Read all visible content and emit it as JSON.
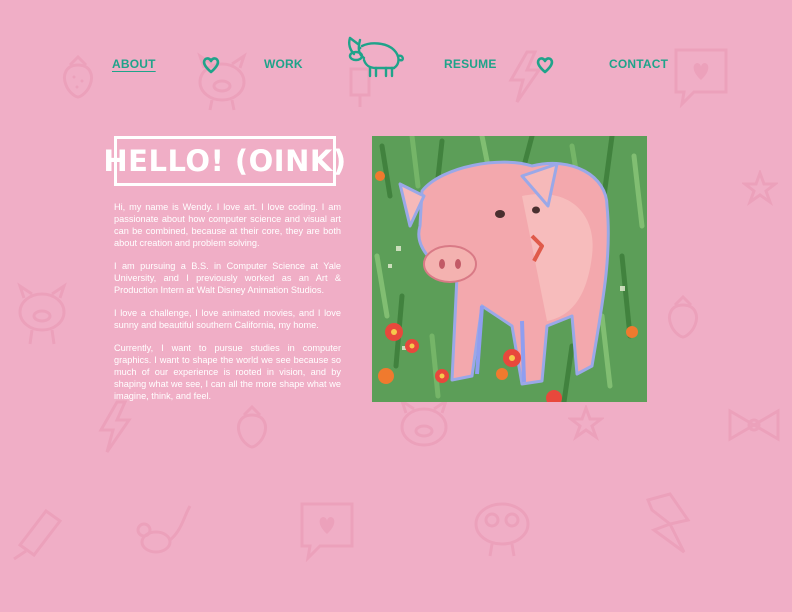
{
  "nav": {
    "about": "ABOUT",
    "work": "WORK",
    "resume": "RESUME",
    "contact": "CONTACT",
    "active": "about"
  },
  "icons": {
    "logo": "pig-logo-icon",
    "nav_separator": "heart-icon",
    "background": [
      "strawberry-icon",
      "pig-icon",
      "speech-heart-icon",
      "lightning-icon",
      "star-icon",
      "bow-icon",
      "popsicle-icon",
      "mouse-icon"
    ]
  },
  "colors": {
    "background": "#f0aec6",
    "accent": "#1fa38a",
    "text": "#ffffff"
  },
  "about": {
    "title": "HELLO! (OINK)",
    "paragraphs": [
      "Hi, my name is Wendy. I love art. I love coding. I am passionate about how computer science and visual art can be combined, because at their core, they are both about creation and problem solving.",
      "I am pursuing a B.S. in Computer Science at Yale University, and I previously worked as an Art & Production Intern at Walt Disney Animation Studios.",
      "I love a challenge, I love animated movies, and I love sunny and beautiful southern California, my home.",
      "Currently, I want to pursue studies in computer graphics. I want to shape the world we see because so much of our experience is rooted in vision, and by shaping what we see, I can all the more shape what we imagine, think, and feel."
    ]
  }
}
